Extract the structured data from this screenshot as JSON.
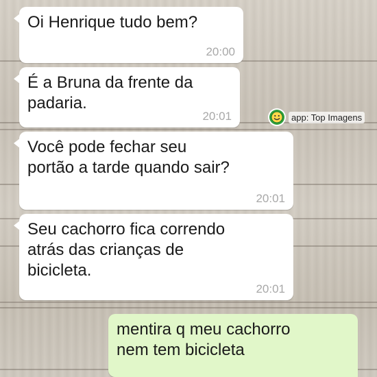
{
  "conversation": {
    "messages": [
      {
        "direction": "incoming",
        "text": "Oi Henrique tudo bem?",
        "time": "20:00"
      },
      {
        "direction": "incoming",
        "text": "É a Bruna da frente da\npadaria.",
        "time": "20:01"
      },
      {
        "direction": "incoming",
        "text": "Você pode fechar seu\nportão  a tarde quando sair?",
        "time": "20:01"
      },
      {
        "direction": "incoming",
        "text": "Seu cachorro fica correndo\natrás das crianças de\nbicicleta.",
        "time": "20:01"
      },
      {
        "direction": "outgoing",
        "text": "mentira q meu cachorro\nnem tem bicicleta",
        "time": ""
      }
    ]
  },
  "watermark": {
    "text": "app: Top Imagens",
    "logo_icon": "smiley-icon"
  },
  "colors": {
    "incoming_bubble": "#ffffff",
    "outgoing_bubble": "#e1f7c9",
    "time_text": "#a8a8a8",
    "watermark_logo": "#2f9e3a"
  }
}
